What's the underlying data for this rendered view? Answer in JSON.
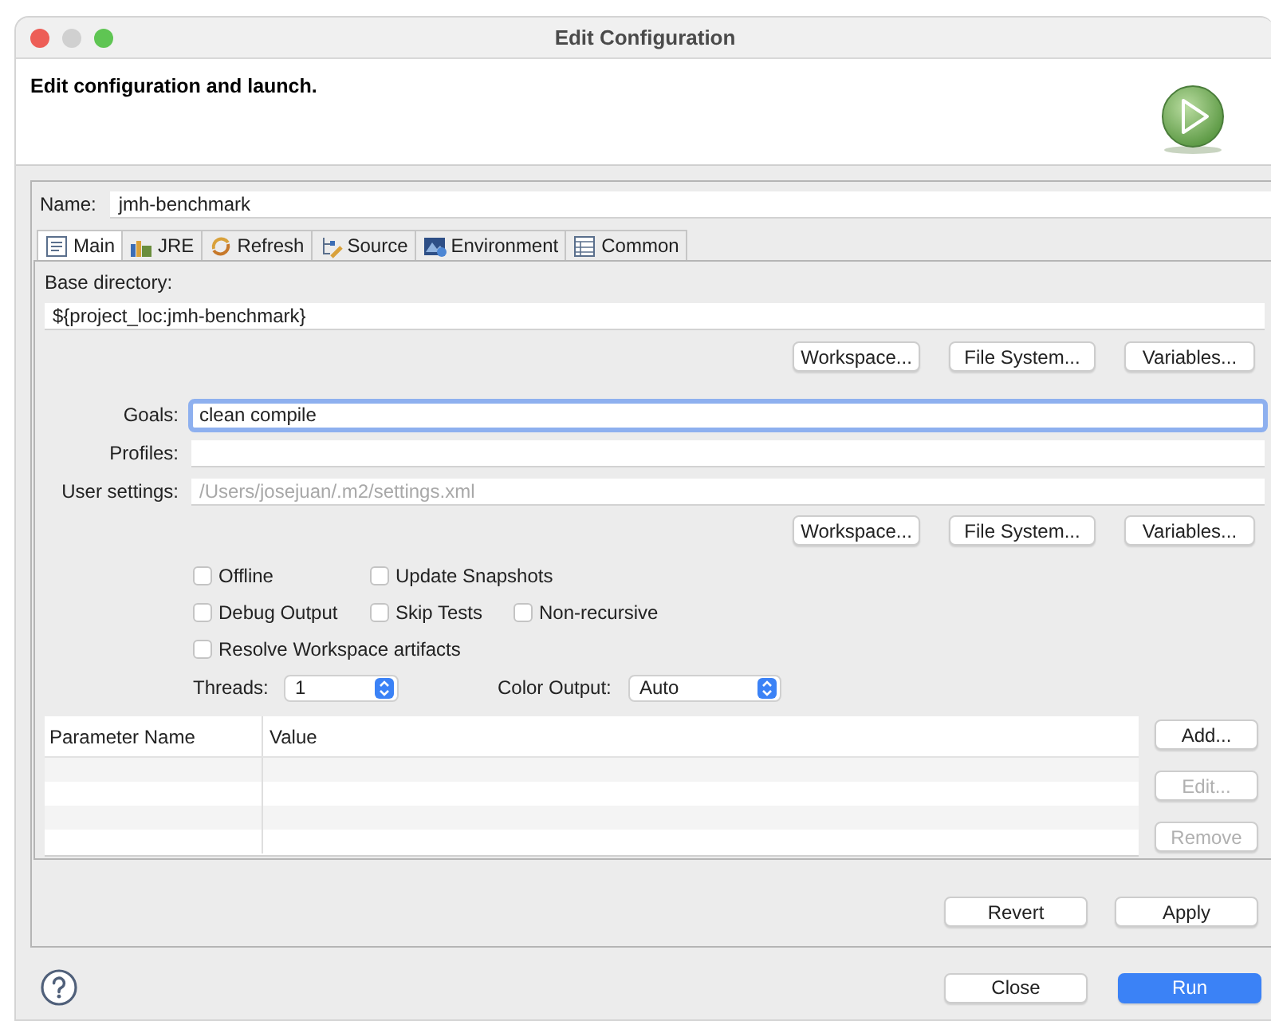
{
  "window": {
    "title": "Edit Configuration"
  },
  "header": {
    "message": "Edit configuration and launch."
  },
  "name": {
    "label": "Name:",
    "value": "jmh-benchmark"
  },
  "tabs": [
    {
      "label": "Main",
      "selected": true
    },
    {
      "label": "JRE",
      "selected": false
    },
    {
      "label": "Refresh",
      "selected": false
    },
    {
      "label": "Source",
      "selected": false
    },
    {
      "label": "Environment",
      "selected": false
    },
    {
      "label": "Common",
      "selected": false
    }
  ],
  "base_directory": {
    "label": "Base directory:",
    "value": "${project_loc:jmh-benchmark}",
    "buttons": [
      "Workspace...",
      "File System...",
      "Variables..."
    ]
  },
  "fields": [
    {
      "label": "Goals:",
      "value": "clean compile",
      "focused": true
    },
    {
      "label": "Profiles:",
      "focused": false
    },
    {
      "label": "User settings:",
      "placeholder": "/Users/josejuan/.m2/settings.xml",
      "focused": false
    }
  ],
  "settings_buttons": [
    "Workspace...",
    "File System...",
    "Variables..."
  ],
  "option_rows": [
    [
      {
        "label": "Offline",
        "checked": false
      },
      {
        "label": "Update Snapshots",
        "checked": false
      }
    ],
    [
      {
        "label": "Debug Output",
        "checked": false
      },
      {
        "label": "Skip Tests",
        "checked": false
      },
      {
        "label": "Non-recursive",
        "checked": false
      }
    ],
    [
      {
        "label": "Resolve Workspace artifacts",
        "checked": false
      }
    ]
  ],
  "threads": {
    "label": "Threads:",
    "value": "1"
  },
  "color_output": {
    "label": "Color Output:",
    "value": "Auto"
  },
  "table": {
    "columns": [
      "Parameter Name",
      "Value"
    ]
  },
  "table_buttons": [
    {
      "label": "Add...",
      "disabled": false
    },
    {
      "label": "Edit...",
      "disabled": true
    },
    {
      "label": "Remove",
      "disabled": true
    }
  ],
  "panel_buttons": [
    "Revert",
    "Apply"
  ],
  "footer_buttons": [
    {
      "label": "Close",
      "kind": "default"
    },
    {
      "label": "Run",
      "kind": "primary"
    }
  ]
}
